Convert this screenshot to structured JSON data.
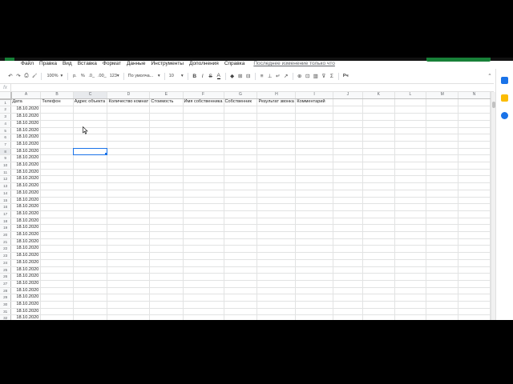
{
  "menu": {
    "items": [
      "Файл",
      "Правка",
      "Вид",
      "Вставка",
      "Формат",
      "Данные",
      "Инструменты",
      "Дополнения",
      "Справка"
    ],
    "last_edit": "Последнее изменение только что"
  },
  "toolbar": {
    "undo": "↶",
    "redo": "↷",
    "print": "⎙",
    "paint_format": "🖌",
    "zoom": "100%",
    "zoom_caret": "▾",
    "currency": "р.",
    "percent": "%",
    "dec_decrease": ".0_",
    "dec_increase": ".00_",
    "more_formats": "123▾",
    "font": "По умолча...",
    "font_caret": "▾",
    "font_size": "10",
    "size_caret": "▾",
    "bold": "B",
    "italic": "I",
    "strike": "S",
    "text_color": "A",
    "fill_color": "◆",
    "borders": "⊞",
    "merge": "⊟",
    "h_align": "≡",
    "v_align": "⊥",
    "wrap": "↵",
    "rotate": "↗",
    "link": "⊕",
    "comment": "⊡",
    "chart": "▥",
    "filter": "⊽",
    "functions": "Σ",
    "input_tools": "Рч",
    "collapse": "⌃"
  },
  "formula_bar": {
    "fx": "fx",
    "value": ""
  },
  "columns": [
    "A",
    "B",
    "C",
    "D",
    "E",
    "F",
    "G",
    "H",
    "I",
    "J",
    "K",
    "L",
    "M",
    "N"
  ],
  "header_row": [
    "Дата",
    "Телефон",
    "Адрес объекта",
    "Количество комнат",
    "Стоимость",
    "Имя собственника",
    "Собственник",
    "Результат звонка",
    "Комментарий",
    "",
    "",
    "",
    "",
    ""
  ],
  "date_value": "18.10.2020",
  "row_count": 32,
  "active_cell": {
    "row": 8,
    "col": 2
  },
  "colors": {
    "accent": "#1a73e8",
    "brand_green": "#188038",
    "header_bg": "#f8f9fa",
    "grid_line": "#e2e3e3"
  },
  "side_panel": {
    "icons": [
      "calendar-icon",
      "keep-icon",
      "tasks-icon"
    ]
  }
}
